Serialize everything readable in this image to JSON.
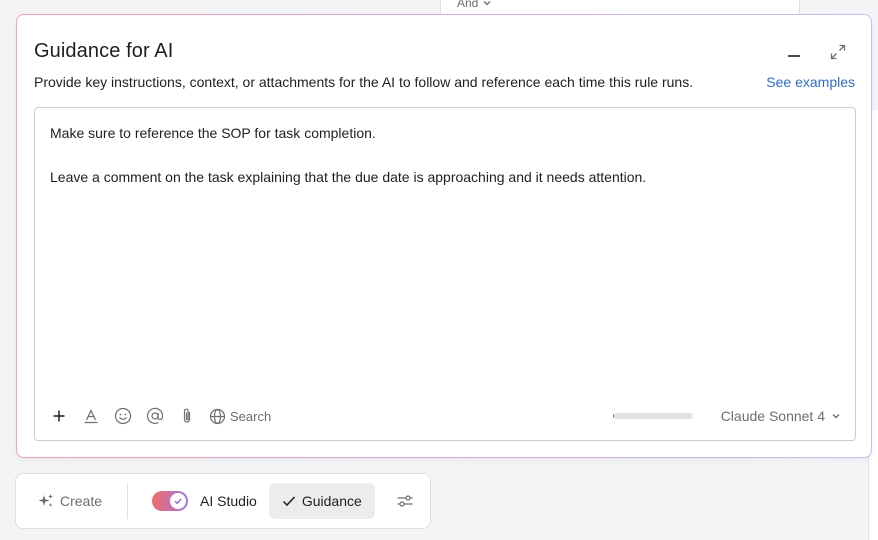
{
  "background": {
    "and_label": "And"
  },
  "modal": {
    "title": "Guidance for AI",
    "subtitle": "Provide key instructions, context, or attachments for the AI to follow and reference each time this rule runs.",
    "see_examples": "See examples",
    "icons": {
      "minimize": "minimize-icon",
      "expand": "expand-icon"
    }
  },
  "editor": {
    "lines": [
      "Make sure to reference the SOP for task completion.",
      "",
      "Leave a comment on the task explaining that the due date is approaching and it needs attention."
    ],
    "toolbar": {
      "icons": [
        "plus-icon",
        "text-format-icon",
        "emoji-icon",
        "mention-icon",
        "attach-icon",
        "globe-icon"
      ],
      "search_label": "Search",
      "usage_fraction": 0.02,
      "model": "Claude Sonnet 4"
    }
  },
  "bottom_bar": {
    "create_label": "Create",
    "ai_studio_label": "AI Studio",
    "ai_studio_enabled": true,
    "guidance_label": "Guidance",
    "icons": {
      "create": "sparkle-icon",
      "guidance": "check-icon",
      "settings": "sliders-icon"
    }
  },
  "colors": {
    "accent_link": "#2f6dc4",
    "toggle_start": "#f06a6a",
    "toggle_end": "#9d7be0",
    "text_primary": "#1e1f21",
    "text_muted": "#6d6e6f"
  }
}
